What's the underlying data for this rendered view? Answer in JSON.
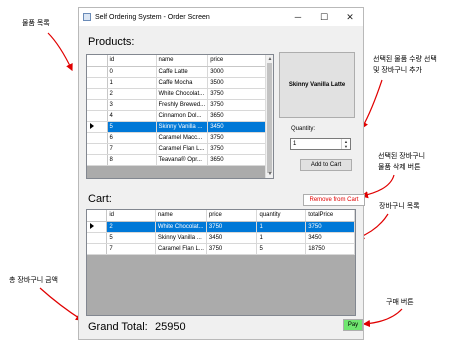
{
  "annotations": {
    "product_list": "물품 목록",
    "select_and_add_line1": "선택된 물품 수량 선택",
    "select_and_add_line2": "및 장바구니 추가",
    "remove_line1": "선택된 장바구니",
    "remove_line2": "물품 삭제 버튼",
    "cart_list": "장바구니 목록",
    "total": "총 장바구니 금액",
    "pay": "구매 버튼"
  },
  "window": {
    "title": "Self Ordering System - Order Screen",
    "minimize": "─",
    "maximize": "☐",
    "close": "✕"
  },
  "products": {
    "label": "Products:",
    "columns": [
      "id",
      "name",
      "price"
    ],
    "rows": [
      {
        "id": "0",
        "name": "Caffe Latte",
        "price": "3000"
      },
      {
        "id": "1",
        "name": "Caffe Mocha",
        "price": "3500"
      },
      {
        "id": "2",
        "name": "White Chocolat...",
        "price": "3750"
      },
      {
        "id": "3",
        "name": "Freshly Brewed...",
        "price": "3750"
      },
      {
        "id": "4",
        "name": "Cinnamon Dol...",
        "price": "3650"
      },
      {
        "id": "5",
        "name": "Skinny Vanilla ...",
        "price": "3450"
      },
      {
        "id": "6",
        "name": "Caramel Macc...",
        "price": "3750"
      },
      {
        "id": "7",
        "name": "Caramel Flan L...",
        "price": "3750"
      },
      {
        "id": "8",
        "name": "Teavana® Opr...",
        "price": "3650"
      }
    ],
    "selected_index": 5
  },
  "preview": {
    "name": "Skinny Vanilla Latte"
  },
  "quantity": {
    "label": "Quantity:",
    "value": "1",
    "up": "▲",
    "down": "▼"
  },
  "add_to_cart": {
    "label": "Add to Cart"
  },
  "remove_from_cart": {
    "label": "Remove from Cart",
    "color": "#e00000"
  },
  "cart": {
    "label": "Cart:",
    "columns": [
      "id",
      "name",
      "price",
      "quantity",
      "totalPrice"
    ],
    "rows": [
      {
        "id": "2",
        "name": "White Chocolat...",
        "price": "3750",
        "quantity": "1",
        "totalPrice": "3750"
      },
      {
        "id": "5",
        "name": "Skinny Vanilla ...",
        "price": "3450",
        "quantity": "1",
        "totalPrice": "3450"
      },
      {
        "id": "7",
        "name": "Caramel Flan L...",
        "price": "3750",
        "quantity": "5",
        "totalPrice": "18750"
      }
    ],
    "selected_index": 0
  },
  "grand_total": {
    "label": "Grand Total:",
    "value": "25950"
  },
  "pay": {
    "label": "Pay",
    "color": "#6fe66f"
  },
  "colors": {
    "selection": "#0078d7"
  }
}
